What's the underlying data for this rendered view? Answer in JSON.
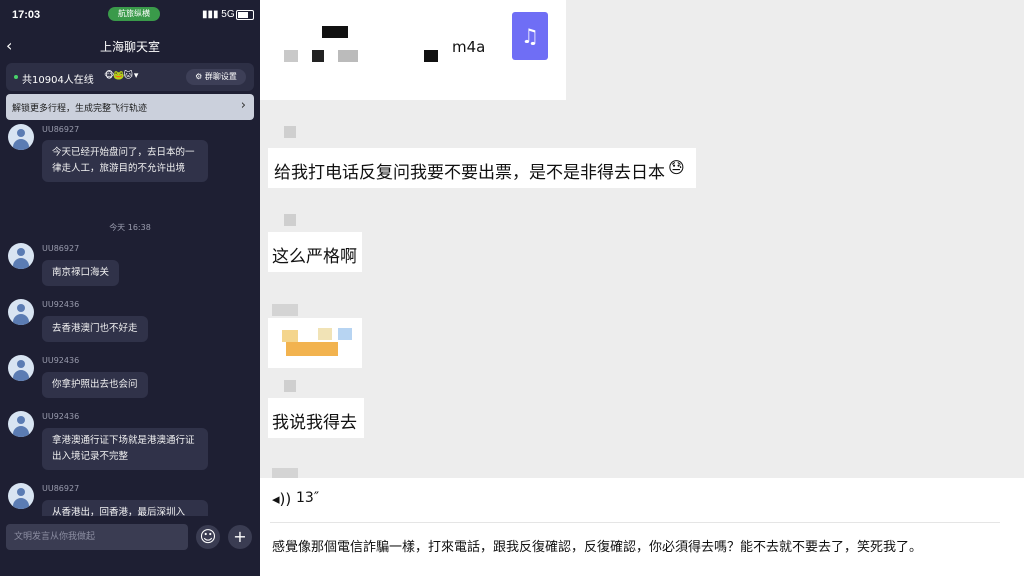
{
  "status": {
    "time": "17:03",
    "pill": "航旅纵横",
    "network": "5G"
  },
  "chat": {
    "title": "上海聊天室",
    "online_text": "共10904人在线",
    "group_settings": "群聊设置",
    "banner": "解锁更多行程，生成完整飞行轨迹",
    "timestamp": "今天 16:38",
    "messages": [
      {
        "user": "UU86927",
        "text": "今天已经开始盘问了，去日本的一律走人工，旅游目的不允许出境"
      },
      {
        "user": "UU86927",
        "text": "南京禄口海关"
      },
      {
        "user": "UU92436",
        "text": "去香港澳门也不好走"
      },
      {
        "user": "UU92436",
        "text": "你拿护照出去也会问"
      },
      {
        "user": "UU92436",
        "text": "拿港澳通行证下场就是港澳通行证出入境记录不完整"
      },
      {
        "user": "UU86927",
        "text": "从香港出，回香港，最后深圳入"
      }
    ],
    "input_placeholder": "文明发言从你我做起"
  },
  "right": {
    "file_suffix": "m4a",
    "msg1": "给我打电话反复问我要不要出票，是不是非得去日本",
    "msg1_emoji": "😓",
    "msg2": "这么严格啊",
    "msg3": "我说我得去",
    "voice_duration": "13″",
    "transcript": "感覺像那個電信詐騙一樣，打來電話，跟我反復確認，反復確認，你必須得去嗎？能不去就不要去了，笑死我了。"
  },
  "colors": {
    "accent_file": "#6f6ef5",
    "left_bg": "#1e1f33",
    "bubble_bg": "#303249"
  }
}
